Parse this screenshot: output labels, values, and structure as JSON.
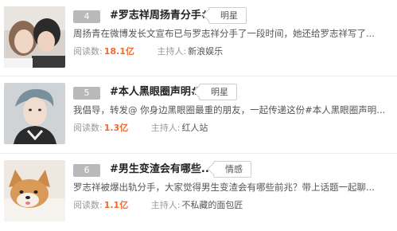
{
  "items": [
    {
      "rank": "4",
      "title": "#罗志祥周扬青分手#",
      "tag": "明星",
      "desc": "周扬青在微博发长文宣布已与罗志祥分手了一段时间，她还给罗志祥写了...",
      "read_label": "阅读数:",
      "read_count": "18.1亿",
      "host_label": "主持人:",
      "host_name": "新浪娱乐",
      "thumb_icon": "couple-photo"
    },
    {
      "rank": "5",
      "title": "#本人黑眼圈声明#",
      "tag": "明星",
      "desc": "我倡导，转发@ 你身边黑眼圈最重的朋友，一起传递这份#本人黑眼圈声明...",
      "read_label": "阅读数:",
      "read_count": "1.3亿",
      "host_label": "主持人:",
      "host_name": "红人站",
      "thumb_icon": "man-portrait"
    },
    {
      "rank": "6",
      "title": "#男生变渣会有哪些...#",
      "tag": "情感",
      "desc": "罗志祥被爆出轨分手，大家觉得男生变渣会有哪些前兆？带上话题一起聊...",
      "read_label": "阅读数:",
      "read_count": "1.1亿",
      "host_label": "主持人:",
      "host_name": "不私藏的面包匠",
      "thumb_icon": "shiba-dog-photo"
    }
  ]
}
